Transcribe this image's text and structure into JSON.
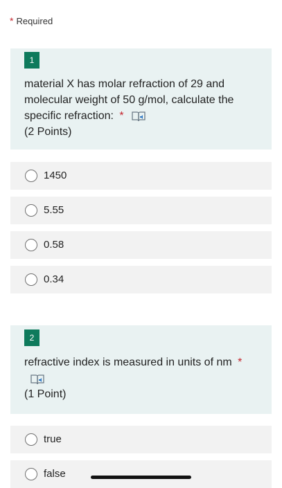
{
  "form": {
    "required_label": "Required",
    "required_star": "*"
  },
  "questions": [
    {
      "number": "1",
      "text": "material X has molar refraction of 29 and molecular weight of 50 g/mol, calculate the specific refraction:",
      "required_star": "*",
      "points": "(2 Points)",
      "options": [
        "1450",
        "5.55",
        "0.58",
        "0.34"
      ]
    },
    {
      "number": "2",
      "text": "refractive index is measured in units of  nm",
      "required_star": "*",
      "points": "(1 Point)",
      "options": [
        "true",
        "false"
      ]
    }
  ],
  "icons": {
    "immersive_reader": "immersive-reader-icon"
  },
  "colors": {
    "accent": "#0e7a5c",
    "required": "#c4262e",
    "question_bg": "#e9f2f2",
    "option_bg": "#f2f2f2"
  }
}
